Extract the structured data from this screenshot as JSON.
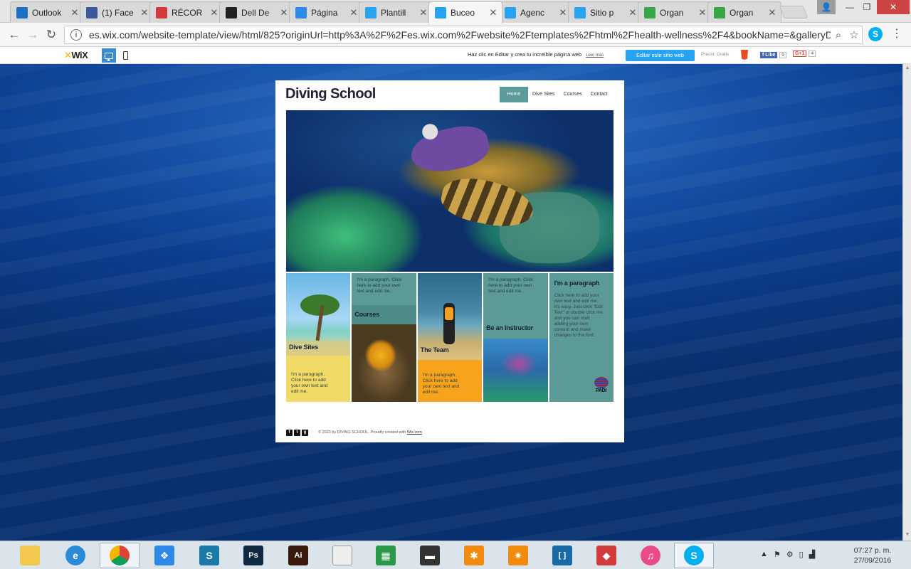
{
  "browser": {
    "tabs": [
      {
        "title": "Outlook",
        "favicon": "outlook-icon",
        "color": "#1f6fc1"
      },
      {
        "title": "(1) Face",
        "favicon": "facebook-icon",
        "color": "#3b5998"
      },
      {
        "title": "RÉCOR",
        "favicon": "record-icon",
        "color": "#d23b3b"
      },
      {
        "title": "Dell De",
        "favicon": "dell-icon",
        "color": "#222222"
      },
      {
        "title": "Página",
        "favicon": "dropbox-icon",
        "color": "#2d8ae8"
      },
      {
        "title": "Plantill",
        "favicon": "wix-icon",
        "color": "#2aa2f2"
      },
      {
        "title": "Buceo",
        "favicon": "wix-icon",
        "color": "#2aa2f2"
      },
      {
        "title": "Agenc",
        "favicon": "wix-icon",
        "color": "#2aa2f2"
      },
      {
        "title": "Sitio p",
        "favicon": "wix-icon",
        "color": "#2aa2f2"
      },
      {
        "title": "Organ",
        "favicon": "plus-icon",
        "color": "#3aa64a"
      },
      {
        "title": "Organ",
        "favicon": "plus-icon",
        "color": "#3aa64a"
      }
    ],
    "url": "es.wix.com/website-template/view/html/825?originUrl=http%3A%2F%2Fes.wix.com%2Fwebsite%2Ftemplates%2Fhtml%2Fhealth-wellness%2F4&bookName=&galleryDc"
  },
  "wixbar": {
    "logo": "WiX",
    "message": "Haz clic en Editar y crea tu increíble página web",
    "learn_more": "Leer más",
    "edit_button": "Editar este sitio web",
    "price": "Precio: Gratis",
    "fb_like": "f Like",
    "fb_count": "9",
    "gplus": "G+1",
    "gplus_count": "4"
  },
  "site": {
    "brand": "Diving School",
    "nav": [
      "Home",
      "Dive Sites",
      "Courses",
      "Contact"
    ],
    "tiles": {
      "dive_sites": {
        "title": "Dive Sites",
        "paragraph": "I'm a paragraph. Click here to add your own text and edit me."
      },
      "courses": {
        "title": "Courses",
        "paragraph": "I'm a paragraph. Click here to add your own text and edit me."
      },
      "team": {
        "title": "The Team",
        "paragraph": "I'm a paragraph. Click here to add your own text and edit me."
      },
      "instructor": {
        "title": "Be an Instructor",
        "paragraph": "I'm a paragraph. Click here to add your own text and edit me."
      },
      "paragraph": {
        "title": "I'm a paragraph",
        "paragraph": "Click here to add your own text and edit me. It's easy. Just click \"Edit Text\" or double click me and you can start adding your own content and make changes to the font.",
        "logo_text": "PADI"
      }
    },
    "footer": {
      "copyright": "© 2023 by DIVING SCHOOL. Proudly created with",
      "link": "Wix.com"
    }
  },
  "taskbar": {
    "apps": [
      {
        "name": "file-explorer-icon",
        "color": "#f2c94c",
        "glyph": ""
      },
      {
        "name": "internet-explorer-icon",
        "color": "#2a8ad8",
        "glyph": "e"
      },
      {
        "name": "chrome-icon",
        "color": "#e8b020",
        "glyph": ""
      },
      {
        "name": "dropbox-icon",
        "color": "#2d8ae8",
        "glyph": "❖"
      },
      {
        "name": "app-s-icon",
        "color": "#1a7aa8",
        "glyph": "S"
      },
      {
        "name": "photoshop-icon",
        "color": "#102a44",
        "glyph": "Ps"
      },
      {
        "name": "illustrator-icon",
        "color": "#3a1a0a",
        "glyph": "Ai"
      },
      {
        "name": "document-icon",
        "color": "#eeeeee",
        "glyph": ""
      },
      {
        "name": "spreadsheet-icon",
        "color": "#2a9a4a",
        "glyph": "▦"
      },
      {
        "name": "device-icon",
        "color": "#333333",
        "glyph": "▬"
      },
      {
        "name": "avast-icon",
        "color": "#f28a10",
        "glyph": "✱"
      },
      {
        "name": "helm-icon",
        "color": "#f28a10",
        "glyph": "✷"
      },
      {
        "name": "bracket-icon",
        "color": "#1a6aa8",
        "glyph": "[ ]"
      },
      {
        "name": "sketchup-icon",
        "color": "#d23b3b",
        "glyph": "◆"
      },
      {
        "name": "itunes-icon",
        "color": "#e84a8a",
        "glyph": "♫"
      },
      {
        "name": "skype-icon",
        "color": "#00aff0",
        "glyph": "S"
      }
    ],
    "time": "07:27 p. m.",
    "date": "27/09/2016"
  }
}
